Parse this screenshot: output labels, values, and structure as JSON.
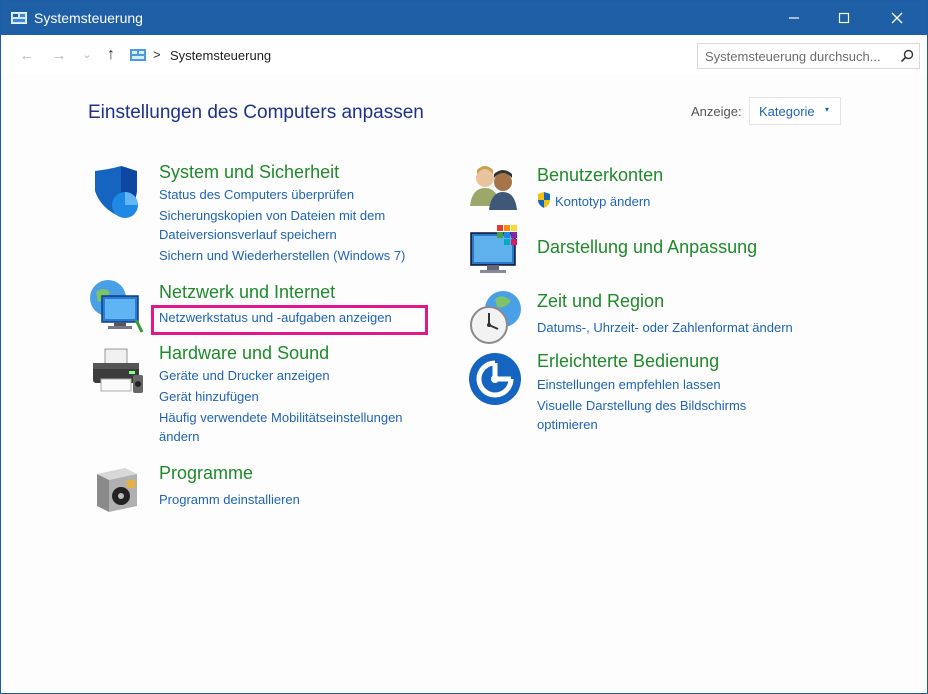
{
  "window": {
    "title": "Systemsteuerung",
    "controls": {
      "minimize": "minimize-icon",
      "maximize": "maximize-icon",
      "close": "close-icon"
    }
  },
  "address_bar": {
    "nav": {
      "back": "←",
      "forward": "→",
      "recent": "⌄",
      "up": "↑"
    },
    "separator": ">",
    "path": "Systemsteuerung",
    "search_placeholder": "Systemsteuerung durchsuch..."
  },
  "header": {
    "title": "Einstellungen des Computers anpassen",
    "view_label": "Anzeige:",
    "view_value": "Kategorie",
    "view_caret": "▾"
  },
  "categories": {
    "system": {
      "title": "System und Sicherheit",
      "links": [
        "Status des Computers überprüfen",
        "Sicherungskopien von Dateien mit dem",
        "Dateiversionsverlauf speichern",
        "Sichern und Wiederherstellen (Windows 7)"
      ]
    },
    "network": {
      "title": "Netzwerk und Internet",
      "links": [
        "Netzwerkstatus und -aufgaben anzeigen"
      ]
    },
    "hardware": {
      "title": "Hardware und Sound",
      "links": [
        "Geräte und Drucker anzeigen",
        "Gerät hinzufügen",
        "Häufig verwendete Mobilitätseinstellungen",
        "ändern"
      ]
    },
    "programs": {
      "title": "Programme",
      "links": [
        "Programm deinstallieren"
      ]
    },
    "accounts": {
      "title": "Benutzerkonten",
      "links": [
        "Kontotyp ändern"
      ]
    },
    "appearance": {
      "title": "Darstellung und Anpassung",
      "links": []
    },
    "region": {
      "title": "Zeit und Region",
      "links": [
        "Datums-, Uhrzeit- oder Zahlenformat ändern"
      ]
    },
    "ease": {
      "title": "Erleichterte Bedienung",
      "links": [
        "Einstellungen empfehlen lassen",
        "Visuelle Darstellung des Bildschirms",
        "optimieren"
      ]
    }
  },
  "colors": {
    "titlebar": "#1f5fa6",
    "category_title": "#1e8a29",
    "link": "#1e64b4",
    "page_title": "#1e3287",
    "highlight": "#e0188d"
  }
}
